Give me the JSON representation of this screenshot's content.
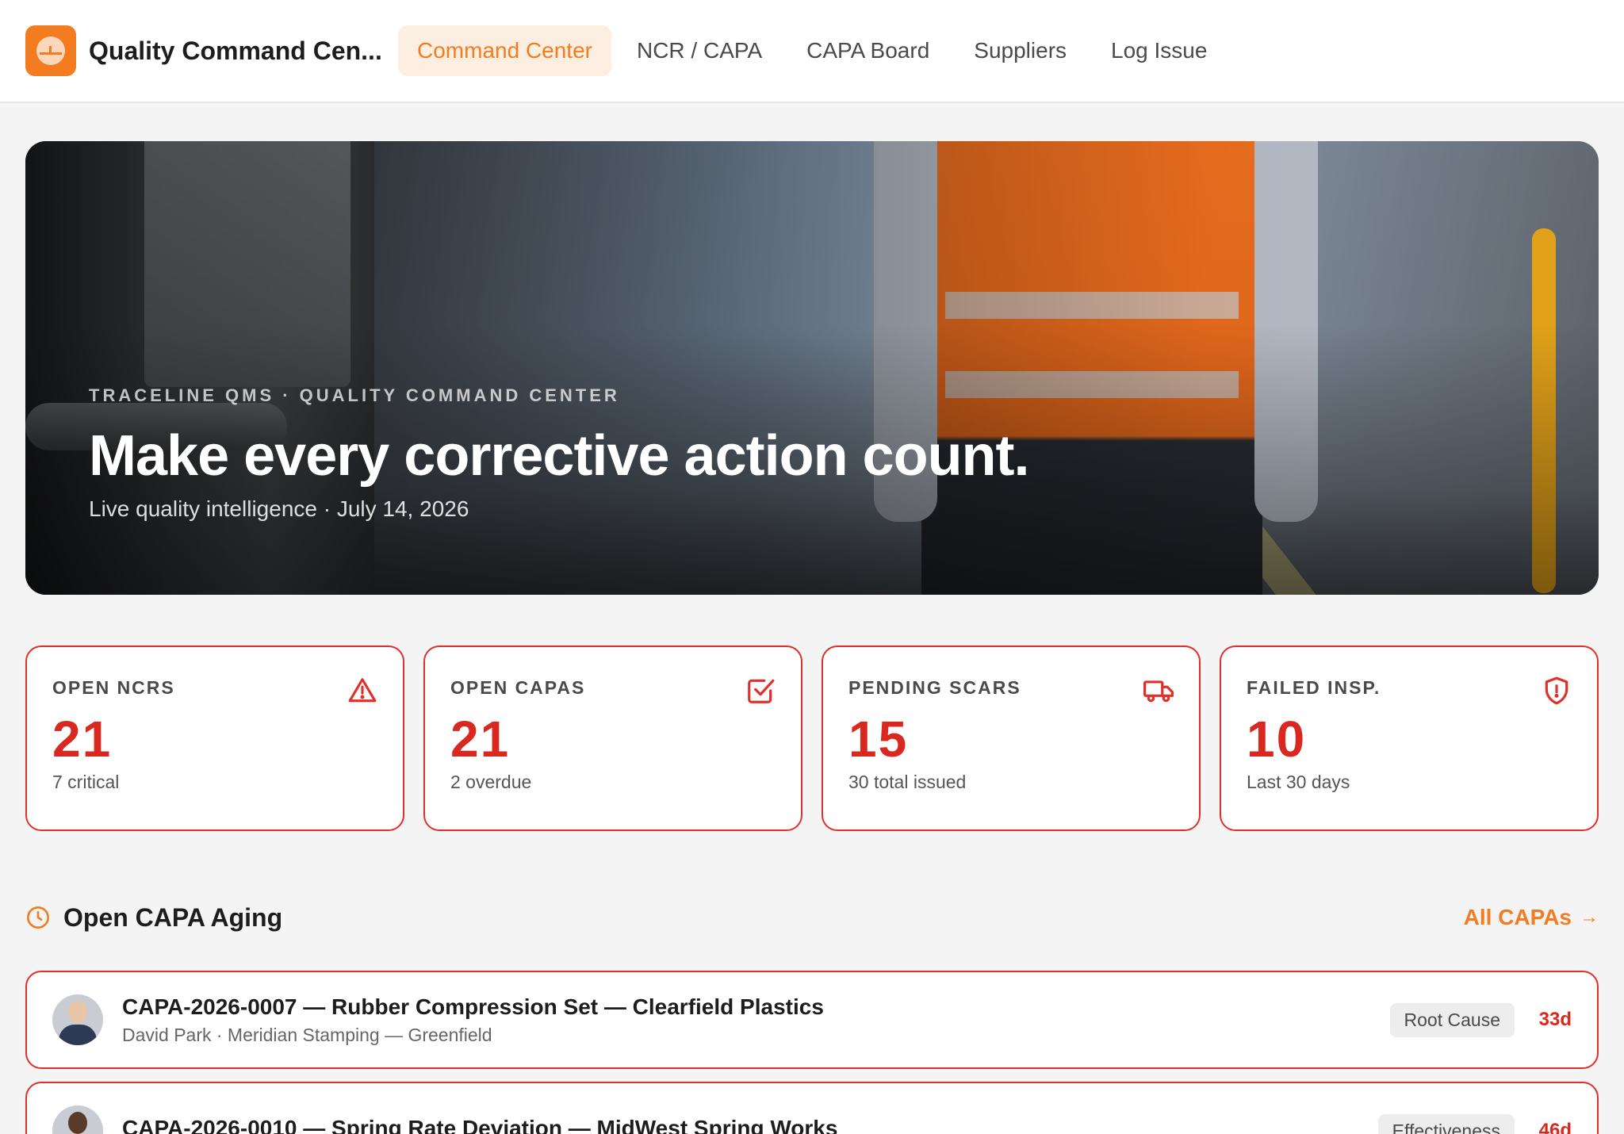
{
  "app": {
    "title": "Quality Command Cen...",
    "accent": "#f47c20",
    "alert": "#d9281f"
  },
  "nav": {
    "items": [
      {
        "label": "Command Center",
        "active": true
      },
      {
        "label": "NCR / CAPA",
        "active": false
      },
      {
        "label": "CAPA Board",
        "active": false
      },
      {
        "label": "Suppliers",
        "active": false
      },
      {
        "label": "Log Issue",
        "active": false
      }
    ]
  },
  "hero": {
    "eyebrow": "TRACELINE QMS · QUALITY COMMAND CENTER",
    "title": "Make every corrective action count.",
    "subtitle": "Live quality intelligence · July 14, 2026"
  },
  "kpis": [
    {
      "label": "OPEN NCRS",
      "value": "21",
      "sub": "7 critical",
      "icon": "warning-triangle-icon"
    },
    {
      "label": "OPEN CAPAS",
      "value": "21",
      "sub": "2 overdue",
      "icon": "checkbox-icon"
    },
    {
      "label": "PENDING SCARS",
      "value": "15",
      "sub": "30 total issued",
      "icon": "truck-icon"
    },
    {
      "label": "FAILED INSP.",
      "value": "10",
      "sub": "Last 30 days",
      "icon": "shield-alert-icon"
    }
  ],
  "aging": {
    "title": "Open CAPA Aging",
    "link_label": "All CAPAs",
    "rows": [
      {
        "title": "CAPA-2026-0007 — Rubber Compression Set — Clearfield Plastics",
        "meta": "David Park · Meridian Stamping — Greenfield",
        "stage": "Root Cause",
        "age": "33d"
      },
      {
        "title": "CAPA-2026-0010 — Spring Rate Deviation — MidWest Spring Works",
        "meta": "",
        "stage": "Effectiveness",
        "age": "46d"
      }
    ]
  }
}
